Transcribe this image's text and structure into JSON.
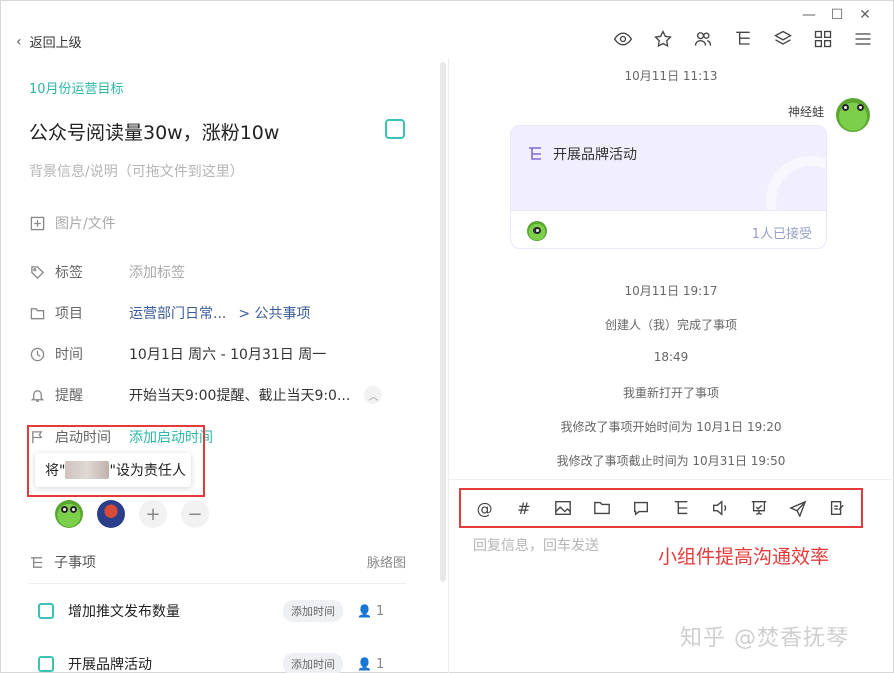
{
  "window": {
    "minimize": "—",
    "maximize": "☐",
    "close": "✕"
  },
  "header": {
    "back_label": "返回上级"
  },
  "toolbar": [
    "eye-icon",
    "star-icon",
    "people-icon",
    "subtask-icon",
    "layers-icon",
    "grid-icon",
    "menu-icon"
  ],
  "task": {
    "breadcrumb": "10月份运营目标",
    "title": "公众号阅读量30w，涨粉10w",
    "description_placeholder": "背景信息/说明（可拖文件到这里）",
    "attachment_label": "图片/文件",
    "fields": {
      "tag": {
        "label": "标签",
        "value": "添加标签"
      },
      "project": {
        "label": "项目",
        "value": "运营部门日常...",
        "sub": "> 公共事项"
      },
      "time": {
        "label": "时间",
        "value": "10月1日 周六 - 10月31日 周一"
      },
      "reminder": {
        "label": "提醒",
        "value": "开始当天9:00提醒、截止当天9:0..."
      },
      "start": {
        "label": "启动时间",
        "value": "添加启动时间"
      }
    },
    "tooltip": {
      "prefix": "将\"",
      "suffix": "\"设为责任人"
    },
    "add_label": "+",
    "remove_label": "−",
    "subtasks": {
      "title": "子事项",
      "view_link": "脉络图",
      "items": [
        {
          "name": "增加推文发布数量",
          "tag": "添加时间",
          "count": "1"
        },
        {
          "name": "开展品牌活动",
          "tag": "添加时间",
          "count": "1"
        }
      ]
    }
  },
  "chat": {
    "timestamp1": "10月11日 11:13",
    "sender": "神经蛙",
    "card_title": "开展品牌活动",
    "card_accept": "1人已接受",
    "timestamp2": "10月11日 19:17",
    "msg1": "创建人（我）完成了事项",
    "timestamp3": "18:49",
    "msg2": "我重新打开了事项",
    "msg3": "我修改了事项开始时间为 10月1日 19:20",
    "msg4": "我修改了事项截止时间为 10月31日 19:50",
    "tools": [
      "@",
      "#",
      "image-icon",
      "folder-icon",
      "comment-icon",
      "subtask-icon",
      "voice-icon",
      "vote-icon",
      "send-icon",
      "note-icon"
    ],
    "reply_placeholder": "回复信息，回车发送",
    "annotation": "小组件提高沟通效率"
  },
  "watermark": "知乎 @焚香抚琴",
  "colors": {
    "accent": "#2bb7a6",
    "highlight": "#e53a3a",
    "card_bg": "#f1eefd"
  }
}
